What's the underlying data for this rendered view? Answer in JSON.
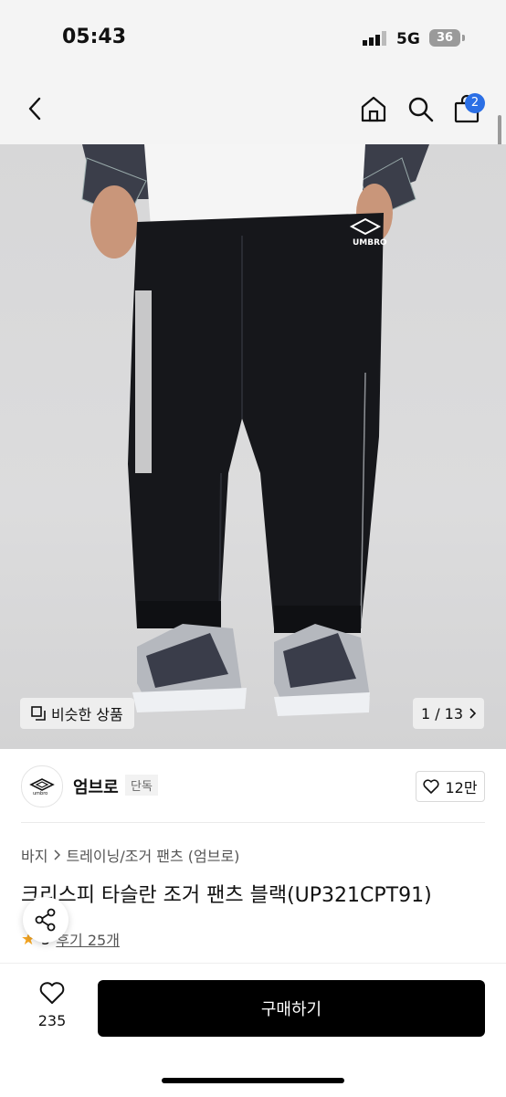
{
  "status": {
    "time": "05:43",
    "network": "5G",
    "battery": "36"
  },
  "nav": {
    "back_icon": "chevron-left-icon",
    "home_icon": "home-icon",
    "search_icon": "search-icon",
    "cart_icon": "shopping-bag-icon",
    "cart_count": "2"
  },
  "image": {
    "similar_label": "비슷한 상품",
    "pager": "1 / 13",
    "brand_mark": "UMBRO"
  },
  "brand": {
    "name": "엄브로",
    "tag": "단독",
    "likes": "12만"
  },
  "product": {
    "breadcrumb": [
      "바지",
      "트레이닝/조거 팬츠 (엄브로)"
    ],
    "title": "크리스피 타슬란 조거 팬츠 블랙(UP321CPT91)",
    "rating": "5",
    "reviews": "후기 25개"
  },
  "bottom": {
    "wish_count": "235",
    "buy_label": "구매하기"
  },
  "colors": {
    "buy_button": "#000000",
    "badge": "#2b6fe5",
    "star": "#f5a623"
  }
}
